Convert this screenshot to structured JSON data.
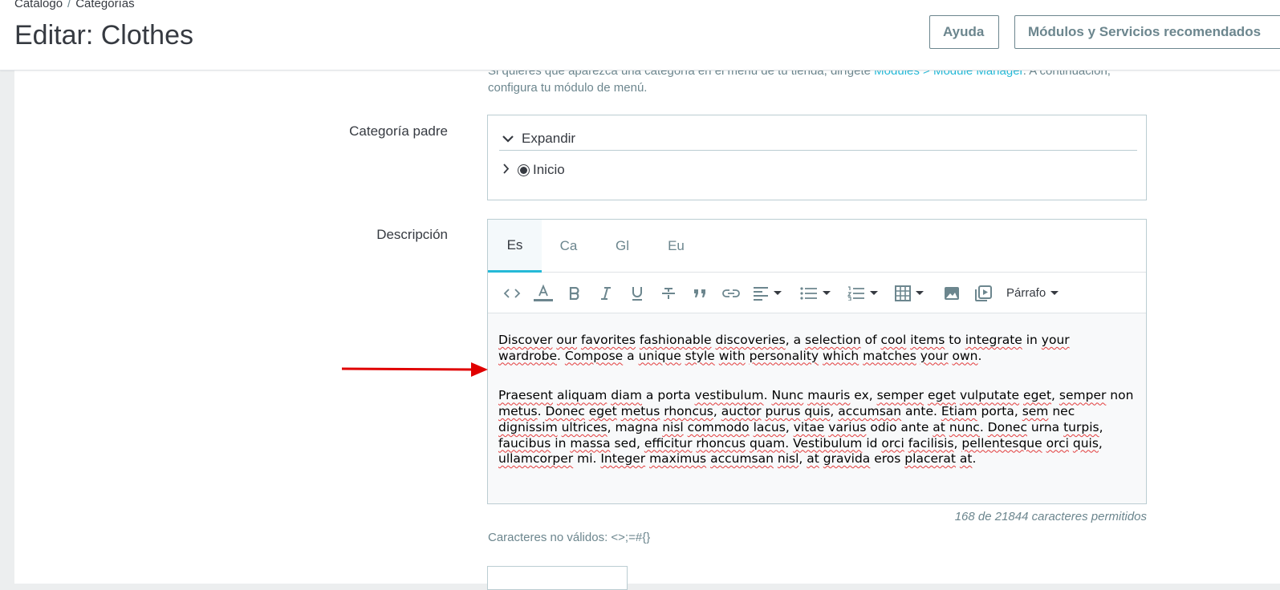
{
  "breadcrumb": {
    "item1": "Catálogo",
    "separator": "/",
    "item2": "Categorías"
  },
  "page_title": "Editar: Clothes",
  "header_buttons": {
    "help": "Ayuda",
    "modules": "Módulos y Servicios recomendados"
  },
  "info": {
    "text_before": "Si quieres que aparezca una categoría en el menú de tu tienda, dirígete ",
    "link": "Modules > Module Manager",
    "text_after": ". A continuación, configura tu módulo de menú."
  },
  "parent_category": {
    "label": "Categoría padre",
    "expand_label": "Expandir",
    "root_label": "Inicio"
  },
  "description": {
    "label": "Descripción",
    "tabs": [
      "Es",
      "Ca",
      "Gl",
      "Eu"
    ],
    "active_tab": "Es",
    "toolbar": {
      "icons": [
        "code-icon",
        "text-color-icon",
        "bold-icon",
        "italic-icon",
        "underline-icon",
        "strikethrough-icon",
        "blockquote-icon",
        "link-icon",
        "align-icon",
        "bullet-list-icon",
        "numbered-list-icon",
        "table-icon",
        "image-icon",
        "media-icon"
      ],
      "format_label": "Párrafo"
    },
    "paragraph1": "Discover our favorites fashionable discoveries, a selection of cool items to integrate in your wardrobe. Compose a unique style with personality which matches your own.",
    "paragraph2": "Praesent aliquam diam a porta vestibulum. Nunc mauris ex, semper eget vulputate eget, semper non metus. Donec eget metus rhoncus, auctor purus quis, accumsan ante. Etiam porta, sem nec dignissim ultrices, magna nisl commodo lacus, vitae varius odio ante at nunc. Donec urna turpis, faucibus in massa sed, efficitur rhoncus quam. Vestibulum id orci facilisis, pellentesque orci quis, ullamcorper mi. Integer maximus accumsan nisl, at gravida eros placerat at."
  },
  "char_count": "168 de 21844 caracteres permitidos",
  "invalid_chars": "Caracteres no válidos: <>;=#{}",
  "colors": {
    "accent": "#25b9d7",
    "text": "#363a41",
    "muted": "#6c868e",
    "border": "#bbcdd2",
    "annotation_arrow": "#e00000"
  }
}
